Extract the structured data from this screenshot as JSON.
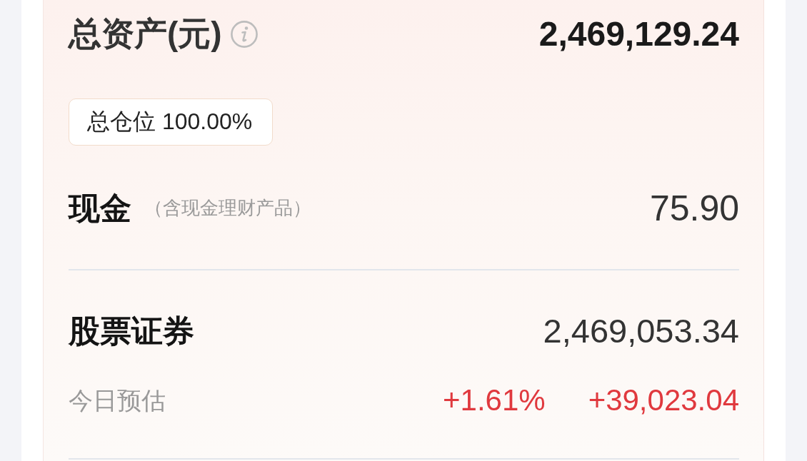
{
  "total_assets": {
    "label": "总资产(元)",
    "value": "2,469,129.24"
  },
  "position_badge": "总仓位 100.00%",
  "cash": {
    "label": "现金",
    "note": "（含现金理财产品）",
    "value": "75.90"
  },
  "stocks": {
    "label": "股票证券",
    "value": "2,469,053.34",
    "today": {
      "label": "今日预估",
      "rising": true,
      "percent": "+1.61%",
      "amount": "+39,023.04"
    }
  }
}
